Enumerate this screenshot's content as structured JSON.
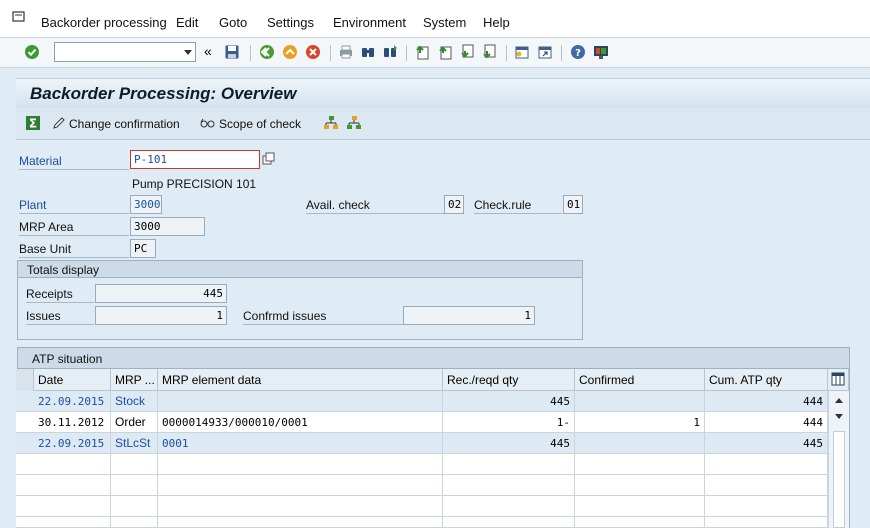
{
  "menubar": {
    "items": [
      "Backorder processing",
      "Edit",
      "Goto",
      "Settings",
      "Environment",
      "System",
      "Help"
    ]
  },
  "toolbar": {
    "icons": [
      "enter-icon",
      "save-icon",
      "back-icon",
      "exit-icon",
      "cancel-icon",
      "print-icon",
      "find-icon",
      "find-next-icon",
      "first-page-icon",
      "previous-page-icon",
      "next-page-icon",
      "last-page-icon",
      "create-session-icon",
      "shortcut-icon",
      "help-icon",
      "customize-layout-icon"
    ],
    "command_value": ""
  },
  "title": "Backorder Processing: Overview",
  "app_toolbar": {
    "change_confirmation": "Change confirmation",
    "scope_of_check": "Scope of check"
  },
  "form": {
    "material_label": "Material",
    "material_value": "P-101",
    "material_desc": "Pump PRECISION 101",
    "plant_label": "Plant",
    "plant_value": "3000",
    "avail_check_label": "Avail. check",
    "avail_check_value": "02",
    "check_rule_label": "Check.rule",
    "check_rule_value": "01",
    "mrp_area_label": "MRP Area",
    "mrp_area_value": "3000",
    "base_unit_label": "Base Unit",
    "base_unit_value": "PC"
  },
  "totals": {
    "title": "Totals display",
    "receipts_label": "Receipts",
    "receipts_value": "445",
    "issues_label": "Issues",
    "issues_value": "1",
    "confirmed_issues_label": "Confrmd issues",
    "confirmed_issues_value": "1"
  },
  "atp": {
    "title": "ATP situation",
    "columns": [
      "Date",
      "MRP ...",
      "MRP element data",
      "Rec./reqd qty",
      "Confirmed",
      "Cum. ATP qty"
    ],
    "rows": [
      {
        "date": "22.09.2015",
        "mrp": "Stock",
        "element": "",
        "qty": "445",
        "confirmed": "",
        "cum": "444"
      },
      {
        "date": "30.11.2012",
        "mrp": "Order",
        "element": "0000014933/000010/0001",
        "qty": "1-",
        "confirmed": "1",
        "cum": "444"
      },
      {
        "date": "22.09.2015",
        "mrp": "StLcSt",
        "element": "0001",
        "qty": "445",
        "confirmed": "",
        "cum": "445"
      }
    ]
  }
}
